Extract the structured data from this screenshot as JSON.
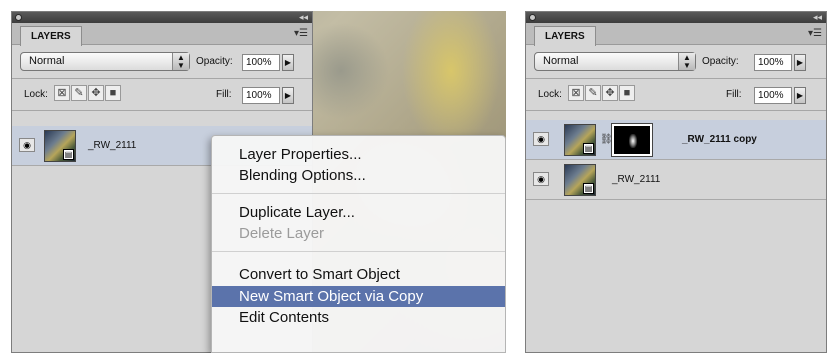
{
  "left": {
    "panel": {
      "tab": "LAYERS",
      "blend_mode": "Normal",
      "opacity_label": "Opacity:",
      "opacity_value": "100%",
      "lock_label": "Lock:",
      "fill_label": "Fill:",
      "fill_value": "100%",
      "layers": [
        {
          "name": "_RW_2111",
          "selected": true
        }
      ]
    },
    "context_menu": {
      "items": [
        "Layer Properties...",
        "Blending Options...",
        "Duplicate Layer...",
        "Delete Layer",
        "Convert to Smart Object",
        "New Smart Object via Copy",
        "Edit Contents"
      ],
      "disabled": [
        "Delete Layer"
      ],
      "highlighted": "New Smart Object via Copy"
    }
  },
  "right": {
    "panel": {
      "tab": "LAYERS",
      "blend_mode": "Normal",
      "opacity_label": "Opacity:",
      "opacity_value": "100%",
      "lock_label": "Lock:",
      "fill_label": "Fill:",
      "fill_value": "100%",
      "layers": [
        {
          "name": "_RW_2111 copy",
          "selected": true
        },
        {
          "name": "_RW_2111",
          "selected": false
        }
      ]
    }
  },
  "icons": {
    "visibility": "eye-icon",
    "smart_object": "smart-object-badge-icon",
    "link": "chain-link-icon",
    "lock_transparent": "lock-transparent-pixels-icon",
    "lock_image": "lock-image-pixels-icon",
    "lock_position": "lock-position-icon",
    "lock_all": "lock-all-icon"
  },
  "colors": {
    "panel_bg": "#d6d6d6",
    "selected_row": "#c7cfdd",
    "menu_highlight": "#5b73ab"
  }
}
